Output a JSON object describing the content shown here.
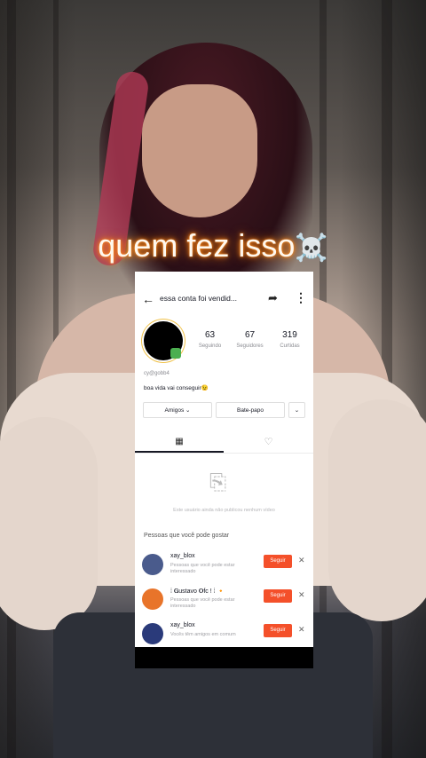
{
  "caption": {
    "text": "quem fez isso",
    "emoji": "☠️"
  },
  "topbar": {
    "title": "essa conta foi vendid...",
    "back_icon": "arrow-left-icon",
    "share_icon": "share-icon",
    "more_icon": "more-vertical-icon"
  },
  "profile": {
    "stats": [
      {
        "value": "63",
        "label": "Seguindo"
      },
      {
        "value": "67",
        "label": "Seguidores"
      },
      {
        "value": "319",
        "label": "Curtidas"
      }
    ],
    "username": "cy@gobb4",
    "bio": "boa vida vai conseguir😉"
  },
  "actions": {
    "friends_label": "Amigos ⌄",
    "chat_label": "Bate-papo",
    "more_label": "⌄"
  },
  "tabs": {
    "grid_icon": "grid-icon",
    "likes_icon": "heart-outline-icon"
  },
  "empty": {
    "icon": "inbox-tray-icon",
    "text": "Este usuário ainda não publicou nenhum vídeo"
  },
  "suggestions": {
    "title": "Pessoas que você pode gostar",
    "items": [
      {
        "name": "xay_blox",
        "subtitle": "Pessoas que você pode estar interessado",
        "follow": "Seguir",
        "avatar_color": "#4a5b8c"
      },
      {
        "name": "⁞ 𝐆ustavo 𝐎fc ! ⁞ 🔸",
        "subtitle": "Pessoas que você pode estar interessado",
        "follow": "Seguir",
        "avatar_color": "#e8742a"
      },
      {
        "name": "xay_blox",
        "subtitle": "Vocês têm amigos em comum",
        "follow": "Seguir",
        "avatar_color": "#2a3a7a"
      }
    ]
  },
  "colors": {
    "follow": "#f4502a",
    "caption_glow": "#ff7a00"
  }
}
